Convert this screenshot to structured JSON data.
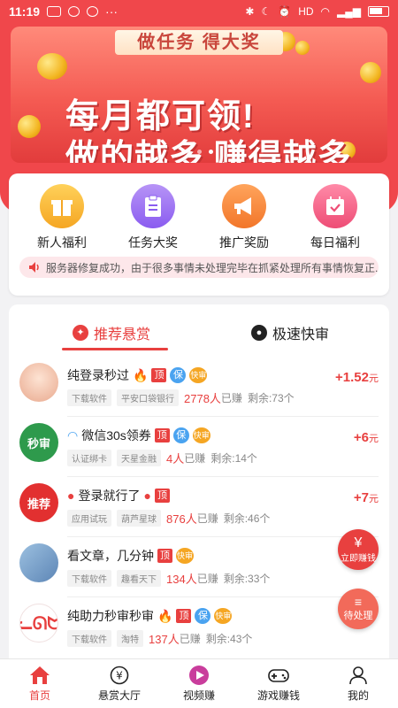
{
  "status": {
    "time": "11:19",
    "network": "HD"
  },
  "banner": {
    "caption": "做任务 得大奖",
    "line1": "每月都可领!",
    "line2": "做的越多 赚得越多"
  },
  "quick": [
    {
      "label": "新人福利",
      "icon": "gift-icon",
      "color": "#f5a623"
    },
    {
      "label": "任务大奖",
      "icon": "clipboard-icon",
      "color": "#9b6cf2"
    },
    {
      "label": "推广奖励",
      "icon": "megaphone-icon",
      "color": "#f37b2d"
    },
    {
      "label": "每日福利",
      "icon": "calendar-check-icon",
      "color": "#f0587a"
    }
  ],
  "notice": "服务器修复成功，由于很多事情未处理完毕在抓紧处理所有事情恢复正...",
  "tabs": {
    "recommended": "推荐悬赏",
    "fast": "极速快审"
  },
  "tasks": [
    {
      "title": "纯登录秒过",
      "badges": [
        "顶",
        "保",
        "快审"
      ],
      "tags": [
        "下载软件",
        "平安口袋银行"
      ],
      "count": "2778人",
      "done": "已赚",
      "remain": "剩余:73个",
      "price": "+1.52",
      "unit": "元",
      "avatar_text": "",
      "avatar_color": "#f4c9b6"
    },
    {
      "title": "微信30s领券",
      "badges": [
        "顶",
        "保",
        "快审"
      ],
      "tags": [
        "认证绑卡",
        "天星金融"
      ],
      "count": "4人",
      "done": "已赚",
      "remain": "剩余:14个",
      "price": "+6",
      "unit": "元",
      "avatar_text": "秒审",
      "avatar_color": "#2e9a4c"
    },
    {
      "title": "登录就行了",
      "badges": [
        "顶"
      ],
      "tags": [
        "应用试玩",
        "葫芦星球"
      ],
      "count": "876人",
      "done": "已赚",
      "remain": "剩余:46个",
      "price": "+7",
      "unit": "元",
      "avatar_text": "推荐",
      "avatar_color": "#e23030"
    },
    {
      "title": "看文章，几分钟",
      "badges": [
        "顶",
        "快审"
      ],
      "tags": [
        "下载软件",
        "趣看天下"
      ],
      "count": "134人",
      "done": "已赚",
      "remain": "剩余:33个",
      "price": "",
      "unit": "",
      "avatar_text": "",
      "avatar_color": "#8fb4d9"
    },
    {
      "title": "纯助力秒审秒审",
      "badges": [
        "顶",
        "保",
        "快审"
      ],
      "tags": [
        "下载软件",
        "淘特"
      ],
      "count": "137人",
      "done": "已赚",
      "remain": "剩余:43个",
      "price": "",
      "unit": "",
      "avatar_text": "",
      "avatar_color": "#f8e7e7"
    }
  ],
  "fab": {
    "earn": "立即赚钱",
    "pending": "待处理"
  },
  "nav": [
    {
      "label": "首页",
      "icon": "home-icon"
    },
    {
      "label": "悬赏大厅",
      "icon": "yuan-icon"
    },
    {
      "label": "视频赚",
      "icon": "video-icon"
    },
    {
      "label": "游戏赚钱",
      "icon": "gamepad-icon"
    },
    {
      "label": "我的",
      "icon": "user-icon"
    }
  ]
}
